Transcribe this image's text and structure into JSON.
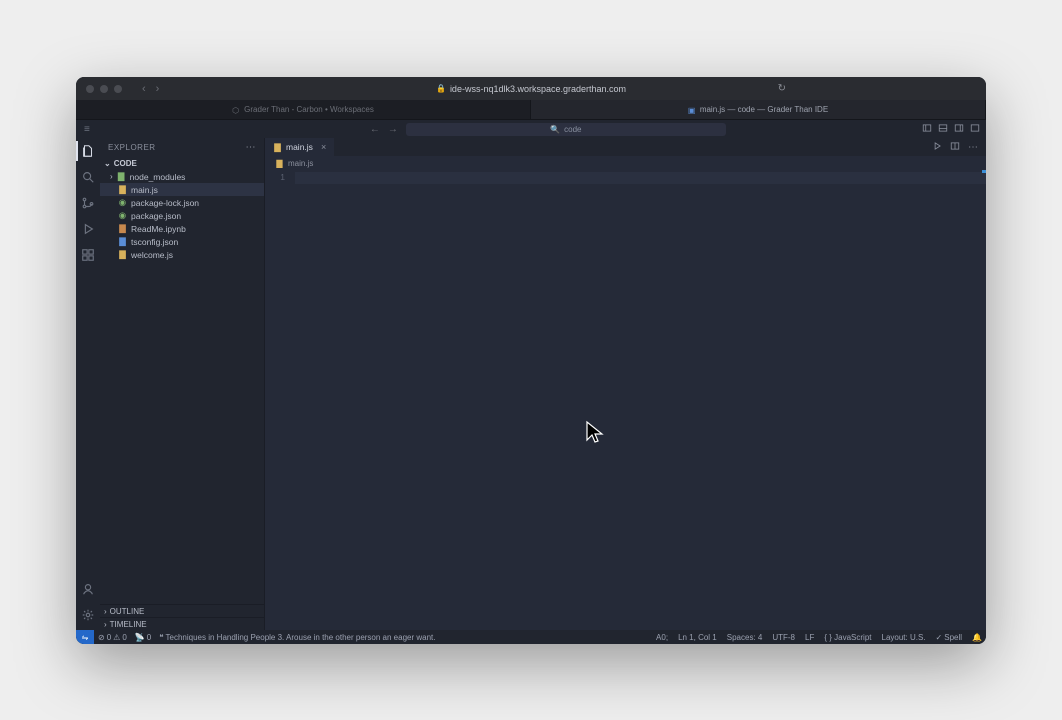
{
  "browser": {
    "url": "ide-wss-nq1dlk3.workspace.graderthan.com",
    "tabs": [
      {
        "label": "Grader Than - Carbon • Workspaces"
      },
      {
        "label": "main.js — code — Grader Than IDE"
      }
    ]
  },
  "topbar": {
    "search_placeholder": "code"
  },
  "sidebar": {
    "title": "EXPLORER",
    "root": "CODE",
    "files": [
      {
        "name": "node_modules",
        "kind": "folder"
      },
      {
        "name": "main.js",
        "kind": "js"
      },
      {
        "name": "package-lock.json",
        "kind": "json"
      },
      {
        "name": "package.json",
        "kind": "json"
      },
      {
        "name": "ReadMe.ipynb",
        "kind": "ipynb"
      },
      {
        "name": "tsconfig.json",
        "kind": "tsconfig"
      },
      {
        "name": "welcome.js",
        "kind": "js"
      }
    ],
    "outline": "OUTLINE",
    "timeline": "TIMELINE"
  },
  "editor": {
    "tab_label": "main.js",
    "breadcrumb": "main.js",
    "line_number": "1"
  },
  "status": {
    "errors": "0",
    "warnings": "0",
    "ports": "0",
    "quote_prefix": "Techniques in Handling People 3. Arouse in the other person an eager want.",
    "brand": "A0;",
    "ln_col": "Ln 1, Col 1",
    "spaces": "Spaces: 4",
    "encoding": "UTF-8",
    "eol": "LF",
    "lang_mode": "{ } JavaScript",
    "layout": "Layout: U.S.",
    "spell": "Spell"
  }
}
